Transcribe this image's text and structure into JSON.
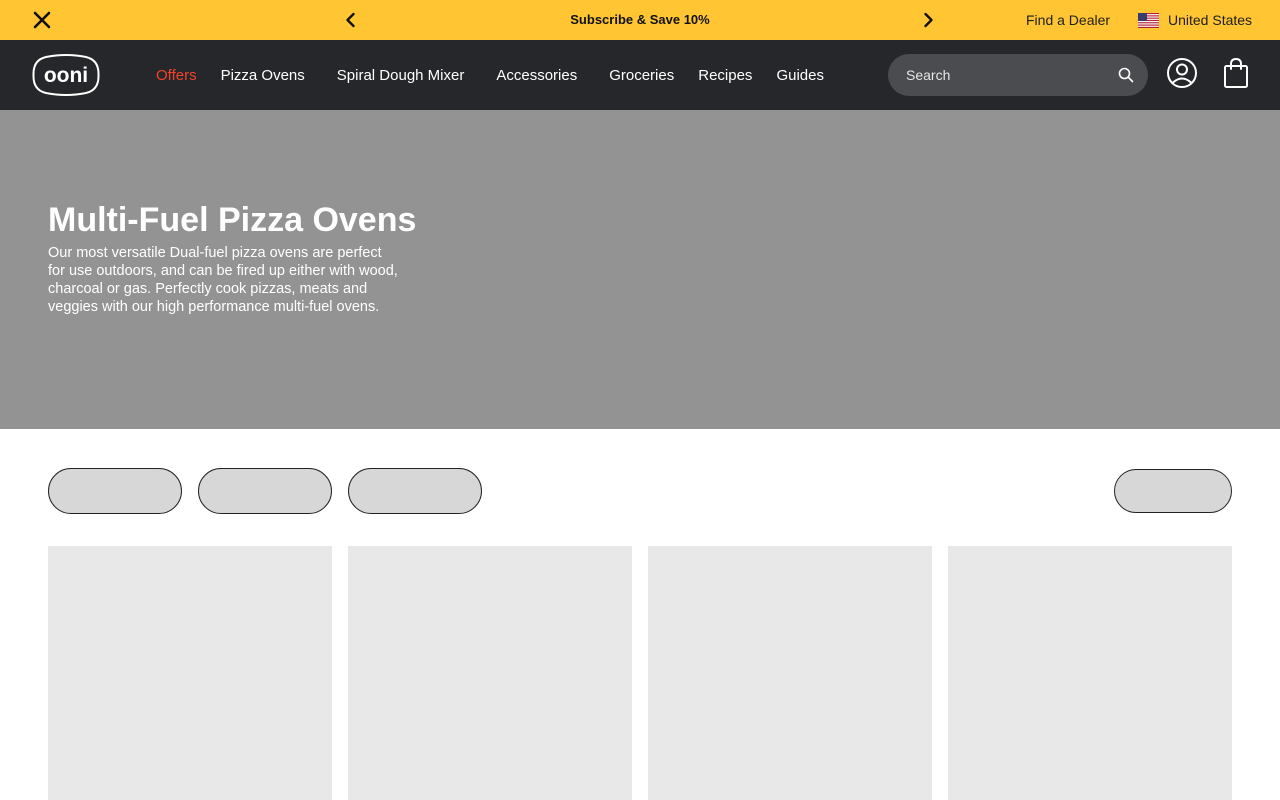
{
  "announcement": {
    "promo_text": "Subscribe & Save 10%",
    "find_dealer": "Find a Dealer",
    "country": "United States",
    "background_color": "#FFC533"
  },
  "header": {
    "logo_text": "ooni",
    "nav": [
      {
        "label": "Offers",
        "highlight_color": "#F0432B"
      },
      {
        "label": "Pizza Ovens"
      },
      {
        "label": "Spiral Dough Mixer"
      },
      {
        "label": "Accessories"
      },
      {
        "label": "Groceries"
      },
      {
        "label": "Recipes"
      },
      {
        "label": "Guides"
      }
    ],
    "search_placeholder": "Search",
    "background_color": "#25272A"
  },
  "hero": {
    "title": "Multi-Fuel Pizza Ovens",
    "description": "Our most versatile Dual-fuel pizza ovens are perfect for use outdoors, and can be fired up either with wood, charcoal or gas. Perfectly cook pizzas, meats and veggies with our high performance multi-fuel ovens."
  },
  "icons": {
    "close": "close-icon",
    "prev": "chevron-left-icon",
    "next": "chevron-right-icon",
    "flag": "us-flag-icon",
    "search": "search-icon",
    "account": "user-icon",
    "cart": "shopping-bag-icon"
  }
}
